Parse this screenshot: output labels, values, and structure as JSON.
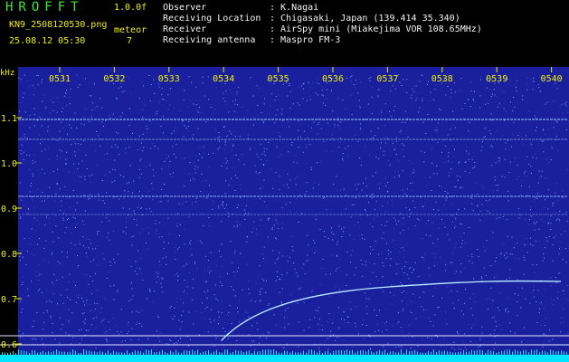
{
  "header": {
    "brand": "HROFFT",
    "version": "1.0.0f",
    "filename": "KN9_2508120530.png",
    "class_label": "meteor",
    "datetime": "25.08.12 05:30",
    "count": "7"
  },
  "info": [
    {
      "key": "Observer",
      "value": ": K.Nagai"
    },
    {
      "key": "Receiving Location",
      "value": ": Chigasaki, Japan (139.414 35.340)"
    },
    {
      "key": "Receiver",
      "value": ": AirSpy mini (Miakejima VOR 108.65MHz)"
    },
    {
      "key": "Receiving antenna",
      "value": ": Maspro FM-3"
    }
  ],
  "spectrogram": {
    "unit_label": "kHz",
    "time_ticks": [
      "0531",
      "0532",
      "0533",
      "0534",
      "0535",
      "0536",
      "0537",
      "0538",
      "0539",
      "0540"
    ],
    "freq_ticks": [
      "1.1",
      "1.0",
      "0.9",
      "0.8",
      "0.7",
      "0.6"
    ],
    "colors": {
      "background": "#1a1f9e",
      "speck": "#6fb0ff",
      "line": "#b9f0ff",
      "bottom_band": "#00e5ff",
      "axis_text": "#f0f000",
      "ref_line": "#e8e8ff"
    }
  }
}
